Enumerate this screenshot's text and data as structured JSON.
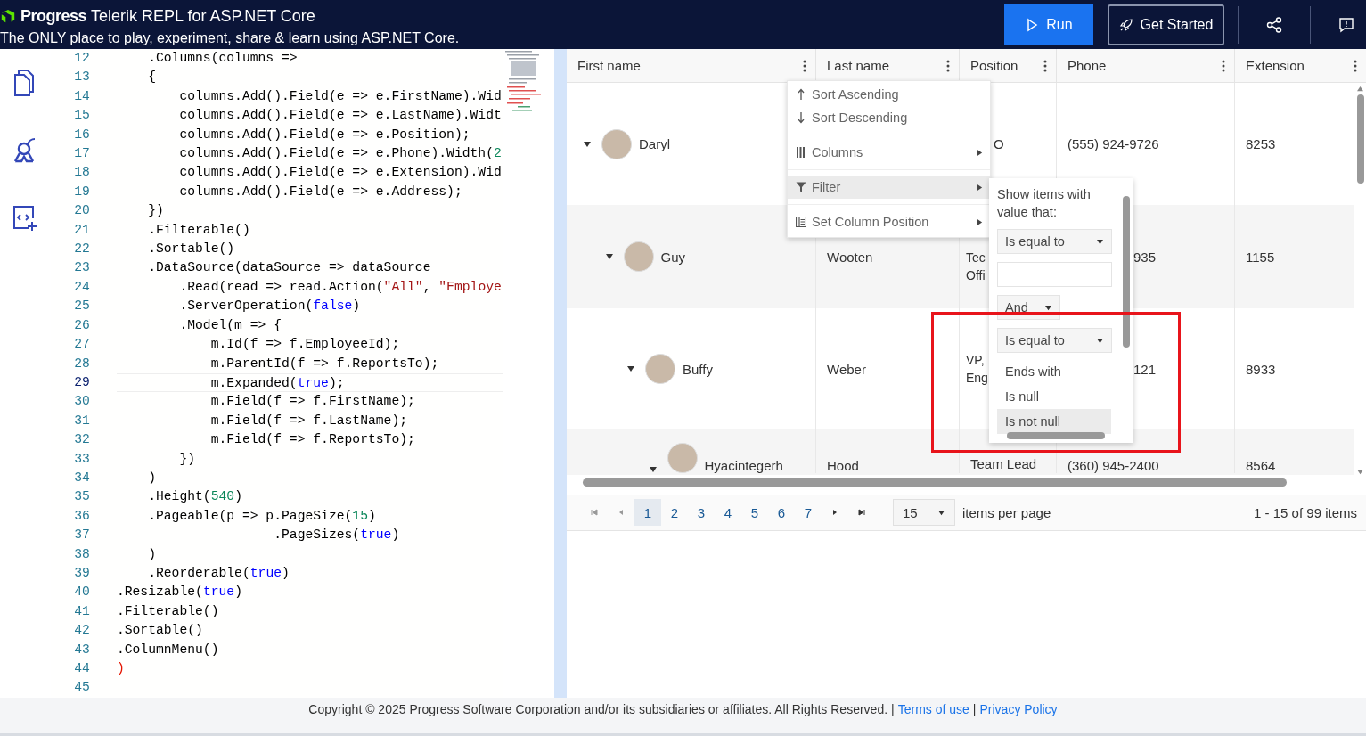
{
  "header": {
    "brand": "Progress",
    "product": "Telerik",
    "title": "REPL for ASP.NET Core",
    "tagline": "The ONLY place to play, experiment, share & learn using ASP.NET Core.",
    "run_button": "Run",
    "get_started_button": "Get Started"
  },
  "editor": {
    "lines": [
      {
        "num": "12",
        "selected": false,
        "tokens": [
          {
            "kind": "plain",
            "text": "    .Columns(columns =>"
          }
        ]
      },
      {
        "num": "13",
        "selected": false,
        "tokens": [
          {
            "kind": "plain",
            "text": "    {"
          }
        ]
      },
      {
        "num": "14",
        "selected": false,
        "tokens": [
          {
            "kind": "plain",
            "text": "        columns.Add().Field(e => e.FirstName).Wid"
          }
        ]
      },
      {
        "num": "15",
        "selected": false,
        "tokens": [
          {
            "kind": "plain",
            "text": "        columns.Add().Field(e => e.LastName).Widt"
          }
        ]
      },
      {
        "num": "16",
        "selected": false,
        "tokens": [
          {
            "kind": "plain",
            "text": "        columns.Add().Field(e => e.Position);"
          }
        ]
      },
      {
        "num": "17",
        "selected": false,
        "tokens": [
          {
            "kind": "plain",
            "text": "        columns.Add().Field(e => e.Phone).Width("
          },
          {
            "kind": "number",
            "text": "2"
          }
        ]
      },
      {
        "num": "18",
        "selected": false,
        "tokens": [
          {
            "kind": "plain",
            "text": "        columns.Add().Field(e => e.Extension).Wid"
          }
        ]
      },
      {
        "num": "19",
        "selected": false,
        "tokens": [
          {
            "kind": "plain",
            "text": "        columns.Add().Field(e => e.Address);"
          }
        ]
      },
      {
        "num": "20",
        "selected": false,
        "tokens": [
          {
            "kind": "plain",
            "text": "    })"
          }
        ]
      },
      {
        "num": "21",
        "selected": false,
        "tokens": [
          {
            "kind": "plain",
            "text": "    .Filterable()"
          }
        ]
      },
      {
        "num": "22",
        "selected": false,
        "tokens": [
          {
            "kind": "plain",
            "text": "    .Sortable()"
          }
        ]
      },
      {
        "num": "23",
        "selected": false,
        "tokens": [
          {
            "kind": "plain",
            "text": "    .DataSource(dataSource => dataSource"
          }
        ]
      },
      {
        "num": "24",
        "selected": false,
        "tokens": [
          {
            "kind": "plain",
            "text": "        .Read(read => read.Action("
          },
          {
            "kind": "string",
            "text": "\"All\""
          },
          {
            "kind": "plain",
            "text": ", "
          },
          {
            "kind": "string",
            "text": "\"Employe"
          }
        ]
      },
      {
        "num": "25",
        "selected": false,
        "tokens": [
          {
            "kind": "plain",
            "text": "        .ServerOperation("
          },
          {
            "kind": "keyword",
            "text": "false"
          },
          {
            "kind": "plain",
            "text": ")"
          }
        ]
      },
      {
        "num": "26",
        "selected": false,
        "tokens": [
          {
            "kind": "plain",
            "text": "        .Model(m => {"
          }
        ]
      },
      {
        "num": "27",
        "selected": false,
        "tokens": [
          {
            "kind": "plain",
            "text": "            m.Id(f => f.EmployeeId);"
          }
        ]
      },
      {
        "num": "28",
        "selected": false,
        "tokens": [
          {
            "kind": "plain",
            "text": "            m.ParentId(f => f.ReportsTo);"
          }
        ]
      },
      {
        "num": "29",
        "selected": true,
        "tokens": [
          {
            "kind": "plain",
            "text": "            m.Expanded("
          },
          {
            "kind": "keyword",
            "text": "true"
          },
          {
            "kind": "plain",
            "text": ");"
          }
        ]
      },
      {
        "num": "30",
        "selected": false,
        "tokens": [
          {
            "kind": "plain",
            "text": "            m.Field(f => f.FirstName);"
          }
        ]
      },
      {
        "num": "31",
        "selected": false,
        "tokens": [
          {
            "kind": "plain",
            "text": "            m.Field(f => f.LastName);"
          }
        ]
      },
      {
        "num": "32",
        "selected": false,
        "tokens": [
          {
            "kind": "plain",
            "text": "            m.Field(f => f.ReportsTo);"
          }
        ]
      },
      {
        "num": "33",
        "selected": false,
        "tokens": [
          {
            "kind": "plain",
            "text": "        })"
          }
        ]
      },
      {
        "num": "34",
        "selected": false,
        "tokens": [
          {
            "kind": "plain",
            "text": "    )"
          }
        ]
      },
      {
        "num": "35",
        "selected": false,
        "tokens": [
          {
            "kind": "plain",
            "text": "    .Height("
          },
          {
            "kind": "number",
            "text": "540"
          },
          {
            "kind": "plain",
            "text": ")"
          }
        ]
      },
      {
        "num": "36",
        "selected": false,
        "tokens": [
          {
            "kind": "plain",
            "text": "    .Pageable(p => p.PageSize("
          },
          {
            "kind": "number",
            "text": "15"
          },
          {
            "kind": "plain",
            "text": ")"
          }
        ]
      },
      {
        "num": "37",
        "selected": false,
        "tokens": [
          {
            "kind": "plain",
            "text": "                    .PageSizes("
          },
          {
            "kind": "keyword",
            "text": "true"
          },
          {
            "kind": "plain",
            "text": ")"
          }
        ]
      },
      {
        "num": "38",
        "selected": false,
        "tokens": [
          {
            "kind": "plain",
            "text": "    )"
          }
        ]
      },
      {
        "num": "39",
        "selected": false,
        "tokens": [
          {
            "kind": "plain",
            "text": "    .Reorderable("
          },
          {
            "kind": "keyword",
            "text": "true"
          },
          {
            "kind": "plain",
            "text": ")"
          }
        ]
      },
      {
        "num": "40",
        "selected": false,
        "tokens": [
          {
            "kind": "plain",
            "text": ".Resizable("
          },
          {
            "kind": "keyword",
            "text": "true"
          },
          {
            "kind": "plain",
            "text": ")"
          }
        ]
      },
      {
        "num": "41",
        "selected": false,
        "tokens": [
          {
            "kind": "plain",
            "text": ".Filterable()"
          }
        ]
      },
      {
        "num": "42",
        "selected": false,
        "tokens": [
          {
            "kind": "plain",
            "text": ".Sortable()"
          }
        ]
      },
      {
        "num": "43",
        "selected": false,
        "tokens": [
          {
            "kind": "plain",
            "text": ".ColumnMenu()"
          }
        ]
      },
      {
        "num": "44",
        "selected": false,
        "tokens": [
          {
            "kind": "error",
            "text": ")"
          }
        ]
      },
      {
        "num": "45",
        "selected": false
      }
    ]
  },
  "grid": {
    "columns": [
      "First name",
      "Last name",
      "Position",
      "Phone",
      "Extension"
    ],
    "rows": [
      {
        "first_name": "Daryl",
        "position": "O",
        "phone": "(555) 924-9726",
        "extension": "8253",
        "expanded": true,
        "children": [
          {
            "first_name": "Guy",
            "last_name": "Wooten",
            "position": "Tec\nOffi",
            "phone": "935",
            "extension": "1155",
            "expanded": true,
            "children": [
              {
                "first_name": "Buffy",
                "last_name": "Weber",
                "position": "VP,\nEng",
                "phone": "121",
                "extension": "8933",
                "expanded": true,
                "children": [
                  {
                    "first_name": "Hyacintegerh",
                    "last_name": "Hood",
                    "position": "Team Lead",
                    "phone": "(360) 945-2400",
                    "extension": "8564",
                    "expanded": true
                  }
                ]
              }
            ]
          }
        ]
      }
    ],
    "column_menu": {
      "items": [
        {
          "kind": "sort-asc",
          "label": "Sort Ascending",
          "selected": false,
          "has_submenu": false
        },
        {
          "kind": "sort-desc",
          "label": "Sort Descending",
          "selected": false,
          "has_submenu": false
        },
        {
          "kind": "columns",
          "label": "Columns",
          "selected": false,
          "has_submenu": true
        },
        {
          "kind": "filter",
          "label": "Filter",
          "selected": true,
          "has_submenu": true
        },
        {
          "kind": "position",
          "label": "Set Column Position",
          "selected": false,
          "has_submenu": true
        }
      ]
    },
    "filter": {
      "prompt": "Show items with value that:",
      "operator": "Is equal to",
      "logic": "And",
      "operator_2": "Is equal to",
      "options": [
        {
          "label": "Ends with",
          "selected": false
        },
        {
          "label": "Is null",
          "selected": false
        },
        {
          "label": "Is not null",
          "selected": true
        }
      ]
    },
    "pager": {
      "pages": [
        {
          "label": "1",
          "selected": true
        },
        {
          "label": "2",
          "selected": false
        },
        {
          "label": "3",
          "selected": false
        },
        {
          "label": "4",
          "selected": false
        },
        {
          "label": "5",
          "selected": false
        },
        {
          "label": "6",
          "selected": false
        },
        {
          "label": "7",
          "selected": false
        }
      ],
      "page_size": "15",
      "page_size_label": "items per page",
      "summary": "1 - 15 of 99 items"
    }
  },
  "footer": {
    "copyright": "Copyright © 2025 Progress Software Corporation and/or its subsidiaries or affiliates. All Rights Reserved.",
    "separators": [
      "|",
      "|"
    ],
    "links": [
      "Terms of use",
      "Privacy Policy"
    ]
  }
}
